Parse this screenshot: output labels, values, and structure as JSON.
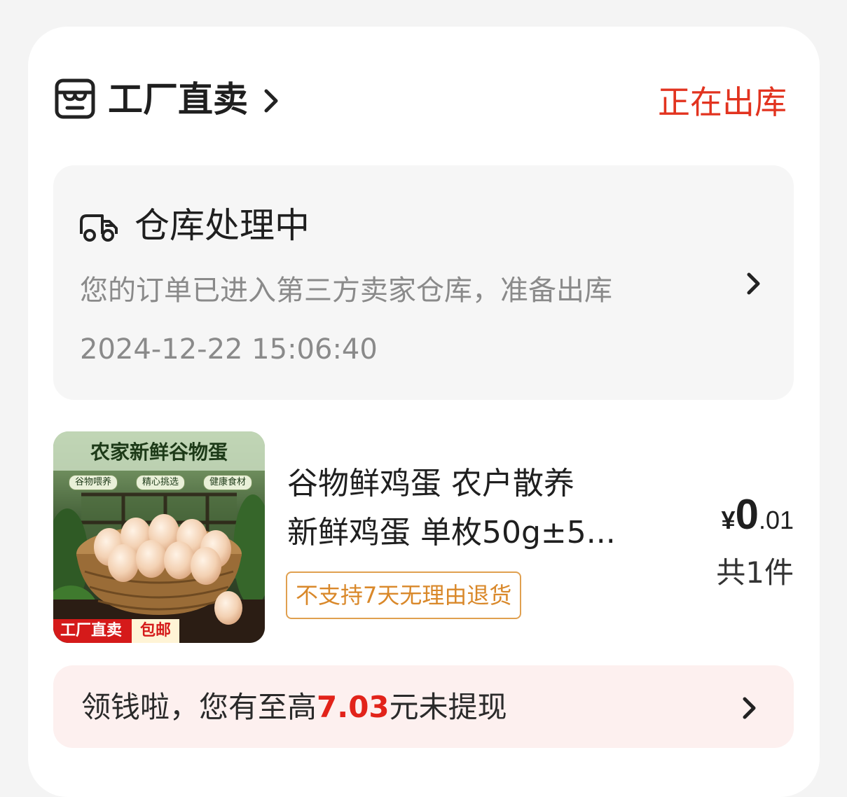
{
  "store": {
    "name": "工厂直卖",
    "status": "正在出库",
    "icon": "store-icon"
  },
  "logistics": {
    "title": "仓库处理中",
    "description": "您的订单已进入第三方卖家仓库，准备出库",
    "time": "2024-12-22 15:06:40",
    "icon": "truck-icon"
  },
  "product": {
    "title_line1": "谷物鲜鸡蛋 农户散养",
    "title_line2": "新鲜鸡蛋 单枚50g±5...",
    "return_policy": "不支持7天无理由退货",
    "price_currency": "¥",
    "price_integer": "0",
    "price_decimal": ".01",
    "quantity": "共1件",
    "image": {
      "banner": "农家新鲜谷物蛋",
      "tags": [
        "谷物喂养",
        "精心挑选",
        "健康食材"
      ],
      "ribbon_main": "工厂直卖",
      "ribbon_sub": "包邮"
    }
  },
  "cash": {
    "prefix": "领钱啦，您有至高",
    "amount": "7.03",
    "suffix": "元未提现"
  },
  "colors": {
    "accent_red": "#e2331f",
    "badge_orange": "#d9882a",
    "muted_gray": "#8a8a8a"
  }
}
